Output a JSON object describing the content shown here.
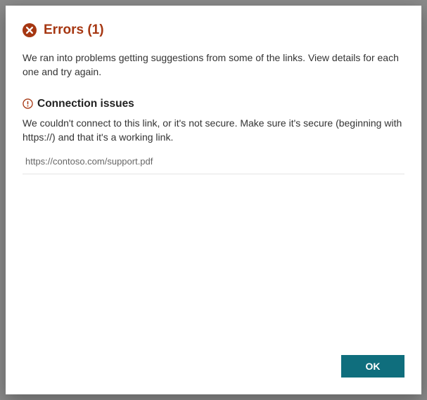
{
  "dialog": {
    "title_prefix": "Errors",
    "error_count": "(1)",
    "intro": "We ran into problems getting suggestions from some of the links. View details for each one and try again.",
    "section": {
      "heading": "Connection issues",
      "body": "We couldn't connect to this link, or it's not secure. Make sure it's secure (beginning with https://) and that it's a working link.",
      "link": "https://contoso.com/support.pdf"
    },
    "ok_label": "OK"
  },
  "colors": {
    "error": "#a63712",
    "accent": "#0f6e7d"
  }
}
